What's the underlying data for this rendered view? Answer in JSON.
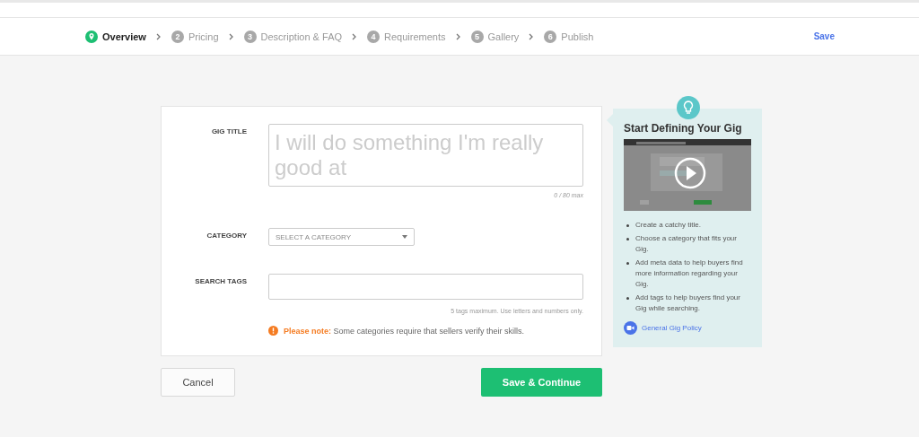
{
  "steps": [
    {
      "label": "Overview",
      "selected": true
    },
    {
      "number": "2",
      "label": "Pricing",
      "selected": false
    },
    {
      "number": "3",
      "label": "Description & FAQ",
      "selected": false
    },
    {
      "number": "4",
      "label": "Requirements",
      "selected": false
    },
    {
      "number": "5",
      "label": "Gallery",
      "selected": false
    },
    {
      "number": "6",
      "label": "Publish",
      "selected": false
    }
  ],
  "save_link": "Save",
  "form": {
    "gig_title": {
      "label": "GIG TITLE",
      "placeholder": "I will do something I'm really good at",
      "counter": "0 / 80 max"
    },
    "category": {
      "label": "CATEGORY",
      "placeholder": "SELECT A CATEGORY"
    },
    "search_tags": {
      "label": "SEARCH TAGS",
      "hint": "5 tags maximum. Use letters and numbers only."
    },
    "note": "**Please note:** Some categories require that sellers verify their skills."
  },
  "buttons": {
    "cancel": "Cancel",
    "continue": "Save & Continue"
  },
  "tips": {
    "title": "Start Defining Your Gig",
    "items": [
      "Create a catchy title.",
      "Choose a category that fits your Gig.",
      "Add meta data to help buyers find more information regarding your Gig.",
      "Add tags to help buyers find your Gig while searching."
    ],
    "policy_link": "General Gig Policy"
  }
}
